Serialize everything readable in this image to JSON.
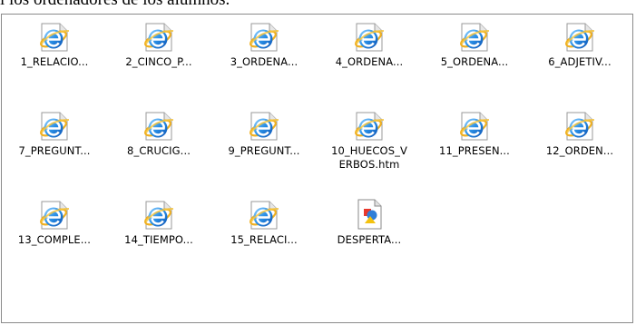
{
  "document": {
    "caption_fragment": "l los ordenadores de los alumnos."
  },
  "files": [
    {
      "label": "1_RELACIO...",
      "icon": "internet-explorer-icon"
    },
    {
      "label": "2_CINCO_P...",
      "icon": "internet-explorer-icon"
    },
    {
      "label": "3_ORDENA...",
      "icon": "internet-explorer-icon"
    },
    {
      "label": "4_ORDENA...",
      "icon": "internet-explorer-icon"
    },
    {
      "label": "5_ORDENA...",
      "icon": "internet-explorer-icon"
    },
    {
      "label": "6_ADJETIV...",
      "icon": "internet-explorer-icon"
    },
    {
      "label": "7_PREGUNT...",
      "icon": "internet-explorer-icon"
    },
    {
      "label": "8_CRUCIG...",
      "icon": "internet-explorer-icon"
    },
    {
      "label": "9_PREGUNT...",
      "icon": "internet-explorer-icon"
    },
    {
      "label": "10_HUECOS_V\nERBOS.htm",
      "icon": "internet-explorer-icon"
    },
    {
      "label": "11_PRESEN...",
      "icon": "internet-explorer-icon"
    },
    {
      "label": "12_ORDEN...",
      "icon": "internet-explorer-icon"
    },
    {
      "label": "13_COMPLE...",
      "icon": "internet-explorer-icon"
    },
    {
      "label": "14_TIEMPO...",
      "icon": "internet-explorer-icon"
    },
    {
      "label": "15_RELACI...",
      "icon": "internet-explorer-icon"
    },
    {
      "label": "DESPERTA...",
      "icon": "multimedia-file-icon"
    }
  ]
}
